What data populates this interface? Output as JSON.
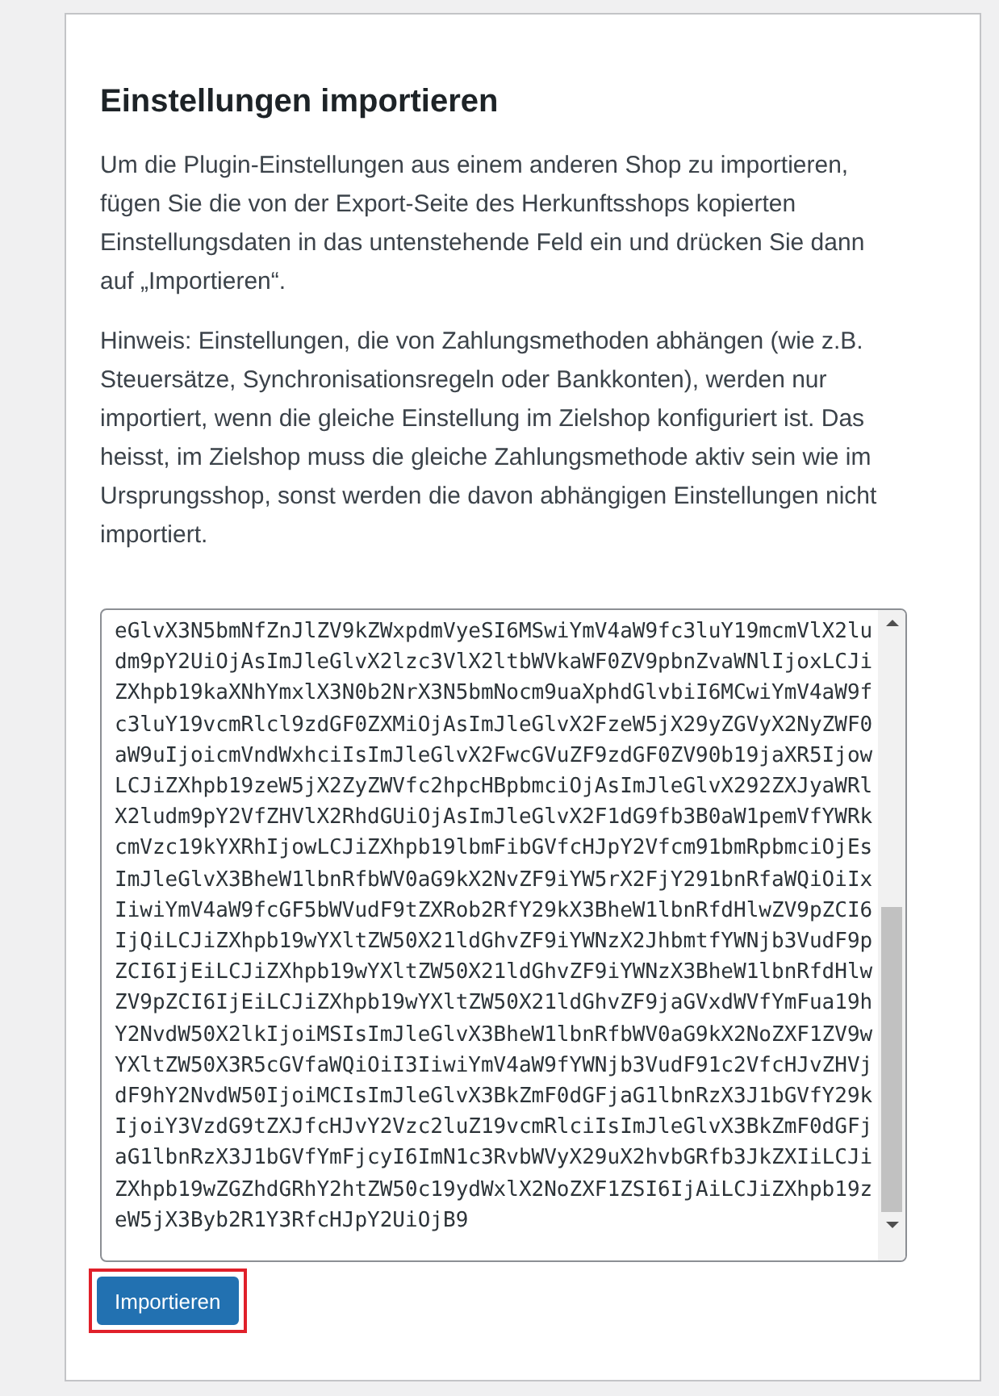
{
  "title": "Einstellungen importieren",
  "paragraphs": [
    "Um die Plugin-Einstellungen aus einem anderen Shop zu importieren, fügen Sie die von der Export-Seite des Herkunftsshops kopierten Einstellungsdaten in das untenstehende Feld ein und drücken Sie dann auf „Importieren“.",
    "Hinweis: Einstellungen, die von Zahlungsmethoden abhängen (wie z.B. Steuersätze, Synchronisationsregeln oder Bankkonten), werden nur importiert, wenn die gleiche Einstellung im Zielshop konfiguriert ist. Das heisst, im Zielshop muss die gleiche Zahlungsmethode aktiv sein wie im Ursprungsshop, sonst werden die davon abhängigen Einstellungen nicht importiert."
  ],
  "settings_field": {
    "lines": [
      "eGlvX3N5bmNfZnJlZV9kZWxpdmVyeSI6MSwiYmV4aW9fc3luY19mcmVlX2lu",
      "dm9pY2UiOjAsImJleGlvX2lzc3VlX2ltbWVkaWF0ZV9pbnZvaWNlIjoxLCJi",
      "ZXhpb19kaXNhYmxlX3N0b2NrX3N5bmNocm9uaXphdGlvbiI6MCwiYmV4aW9f",
      "c3luY19vcmRlcl9zdGF0ZXMiOjAsImJleGlvX2FzeW5jX29yZGVyX2NyZWF0",
      "aW9uIjoicmVndWxhciIsImJleGlvX2FwcGVuZF9zdGF0ZV90b19jaXR5Ijow",
      "LCJiZXhpb19zeW5jX2ZyZWVfc2hpcHBpbmciOjAsImJleGlvX292ZXJyaWRl",
      "X2ludm9pY2VfZHVlX2RhdGUiOjAsImJleGlvX2F1dG9fb3B0aW1pemVfYWRk",
      "cmVzc19kYXRhIjowLCJiZXhpb19lbmFibGVfcHJpY2Vfcm91bmRpbmciOjEs",
      "ImJleGlvX3BheW1lbnRfbWV0aG9kX2NvZF9iYW5rX2FjY291bnRfaWQiOiIx",
      "IiwiYmV4aW9fcGF5bWVudF9tZXRob2RfY29kX3BheW1lbnRfdHlwZV9pZCI6",
      "IjQiLCJiZXhpb19wYXltZW50X21ldGhvZF9iYWNzX2JhbmtfYWNjb3VudF9p",
      "ZCI6IjEiLCJiZXhpb19wYXltZW50X21ldGhvZF9iYWNzX3BheW1lbnRfdHlw",
      "ZV9pZCI6IjEiLCJiZXhpb19wYXltZW50X21ldGhvZF9jaGVxdWVfYmFua19h",
      "Y2NvdW50X2lkIjoiMSIsImJleGlvX3BheW1lbnRfbWV0aG9kX2NoZXF1ZV9w",
      "YXltZW50X3R5cGVfaWQiOiI3IiwiYmV4aW9fYWNjb3VudF91c2VfcHJvZHVj",
      "dF9hY2NvdW50IjoiMCIsImJleGlvX3BkZmF0dGFjaG1lbnRzX3J1bGVfY29k",
      "IjoiY3VzdG9tZXJfcHJvY2Vzc2luZ19vcmRlciIsImJleGlvX3BkZmF0dGFj",
      "aG1lbnRzX3J1bGVfYmFjcyI6ImN1c3RvbWVyX29uX2hvbGRfb3JkZXIiLCJi",
      "ZXhpb19wZGZhdGRhY2htZW50c19ydWxlX2NoZXF1ZSI6IjAiLCJiZXhpb19z",
      "eW5jX3Byb2R1Y3RfcHJpY2UiOjB9"
    ]
  },
  "import_button": {
    "label": "Importieren",
    "highlighted": true
  }
}
